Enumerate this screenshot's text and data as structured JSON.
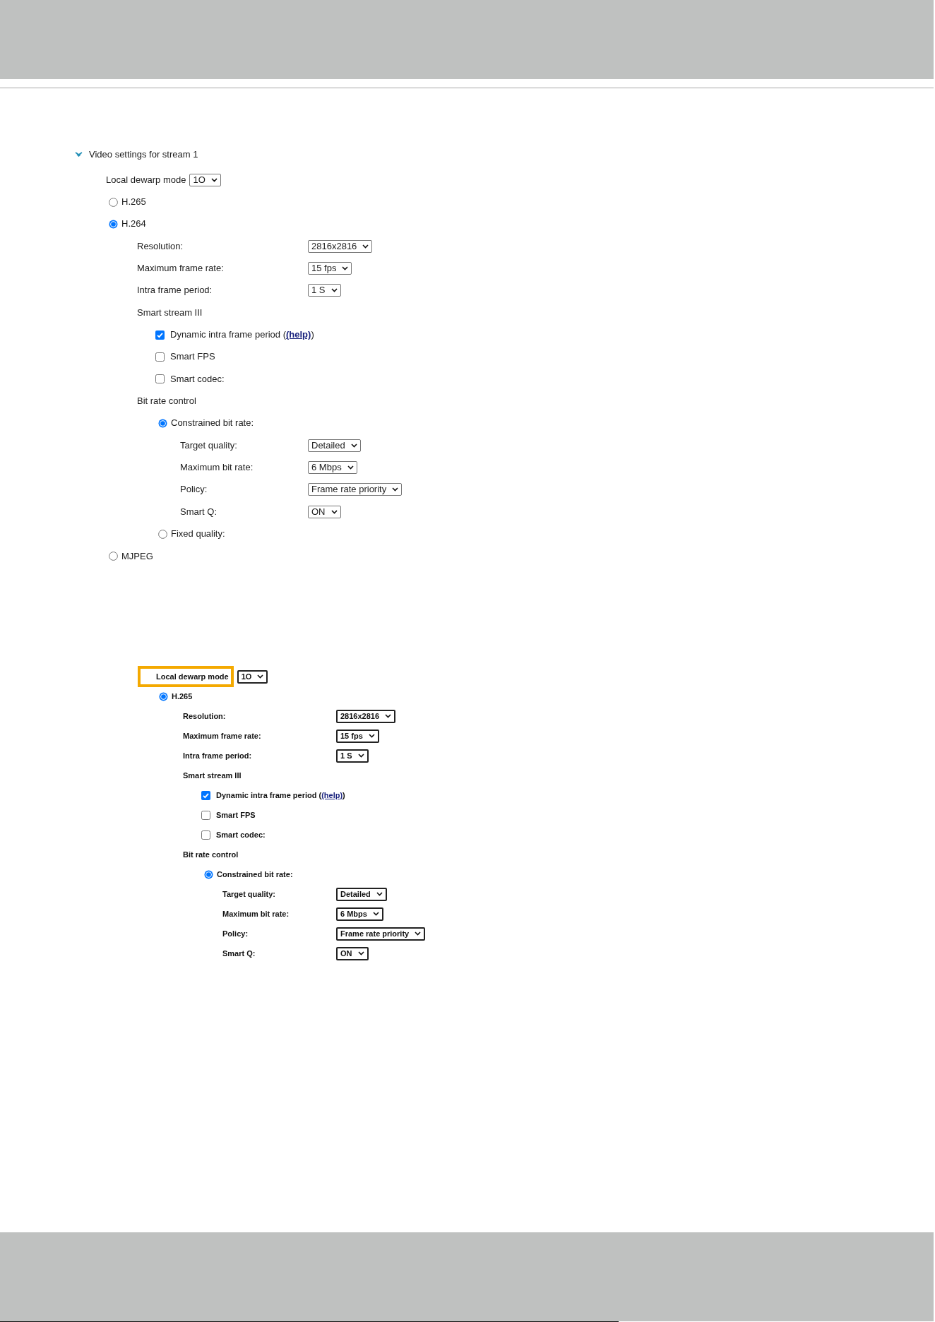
{
  "section": {
    "title": "Video settings for stream 1",
    "expanded": true
  },
  "settings": {
    "rows": [
      {
        "kind": "select",
        "label": "Local dewarp mode",
        "value": "1O",
        "highlighted": false
      },
      {
        "kind": "radio",
        "label": "H.265",
        "selected": false
      },
      {
        "kind": "radio",
        "label": "H.264",
        "selected": true,
        "children": [
          {
            "kind": "field",
            "label": "Resolution:",
            "value": "2816x2816"
          },
          {
            "kind": "field",
            "label": "Maximum frame rate:",
            "value": "15 fps"
          },
          {
            "kind": "field",
            "label": "Intra frame period:",
            "value": "1 S"
          },
          {
            "kind": "heading",
            "label": "Smart stream III",
            "children": [
              {
                "kind": "checkbox",
                "label": "Dynamic intra frame period (",
                "link": "(help)",
                "label_end": ")",
                "checked": true
              },
              {
                "kind": "checkbox",
                "label": "Smart FPS",
                "checked": false
              },
              {
                "kind": "checkbox",
                "label": "Smart codec:",
                "checked": false
              }
            ]
          },
          {
            "kind": "heading",
            "label": "Bit rate control",
            "children": [
              {
                "kind": "radio",
                "label": "Constrained bit rate:",
                "selected": true,
                "children": [
                  {
                    "kind": "field",
                    "label": "Target quality:",
                    "value": "Detailed"
                  },
                  {
                    "kind": "field",
                    "label": "Maximum bit rate:",
                    "value": "6 Mbps"
                  },
                  {
                    "kind": "field",
                    "label": "Policy:",
                    "value": "Frame rate priority"
                  },
                  {
                    "kind": "field",
                    "label": "Smart Q:",
                    "value": "ON"
                  }
                ]
              },
              {
                "kind": "radio",
                "label": "Fixed quality:",
                "selected": false
              }
            ]
          }
        ]
      },
      {
        "kind": "radio",
        "label": "MJPEG",
        "selected": false
      }
    ]
  },
  "screenshot": {
    "rows": [
      {
        "kind": "select",
        "label": "Local dewarp mode",
        "value": "1O",
        "highlighted": true
      },
      {
        "kind": "radio",
        "label": "H.265",
        "selected": true,
        "children": [
          {
            "kind": "field",
            "label": "Resolution:",
            "value": "2816x2816"
          },
          {
            "kind": "field",
            "label": "Maximum frame rate:",
            "value": "15 fps"
          },
          {
            "kind": "field",
            "label": "Intra frame period:",
            "value": "1 S"
          },
          {
            "kind": "heading",
            "label": "Smart stream III",
            "children": [
              {
                "kind": "checkbox",
                "label": "Dynamic intra frame period (",
                "link": "(help)",
                "label_end": ")",
                "checked": true
              },
              {
                "kind": "checkbox",
                "label": "Smart FPS",
                "checked": false
              },
              {
                "kind": "checkbox",
                "label": "Smart codec:",
                "checked": false
              }
            ]
          },
          {
            "kind": "heading",
            "label": "Bit rate control",
            "children": [
              {
                "kind": "radio",
                "label": "Constrained bit rate:",
                "selected": true,
                "children": [
                  {
                    "kind": "field",
                    "label": "Target quality:",
                    "value": "Detailed"
                  },
                  {
                    "kind": "field",
                    "label": "Maximum bit rate:",
                    "value": "6 Mbps"
                  },
                  {
                    "kind": "field",
                    "label": "Policy:",
                    "value": "Frame rate priority"
                  },
                  {
                    "kind": "field",
                    "label": "Smart Q:",
                    "value": "ON"
                  }
                ]
              }
            ]
          }
        ]
      }
    ]
  }
}
